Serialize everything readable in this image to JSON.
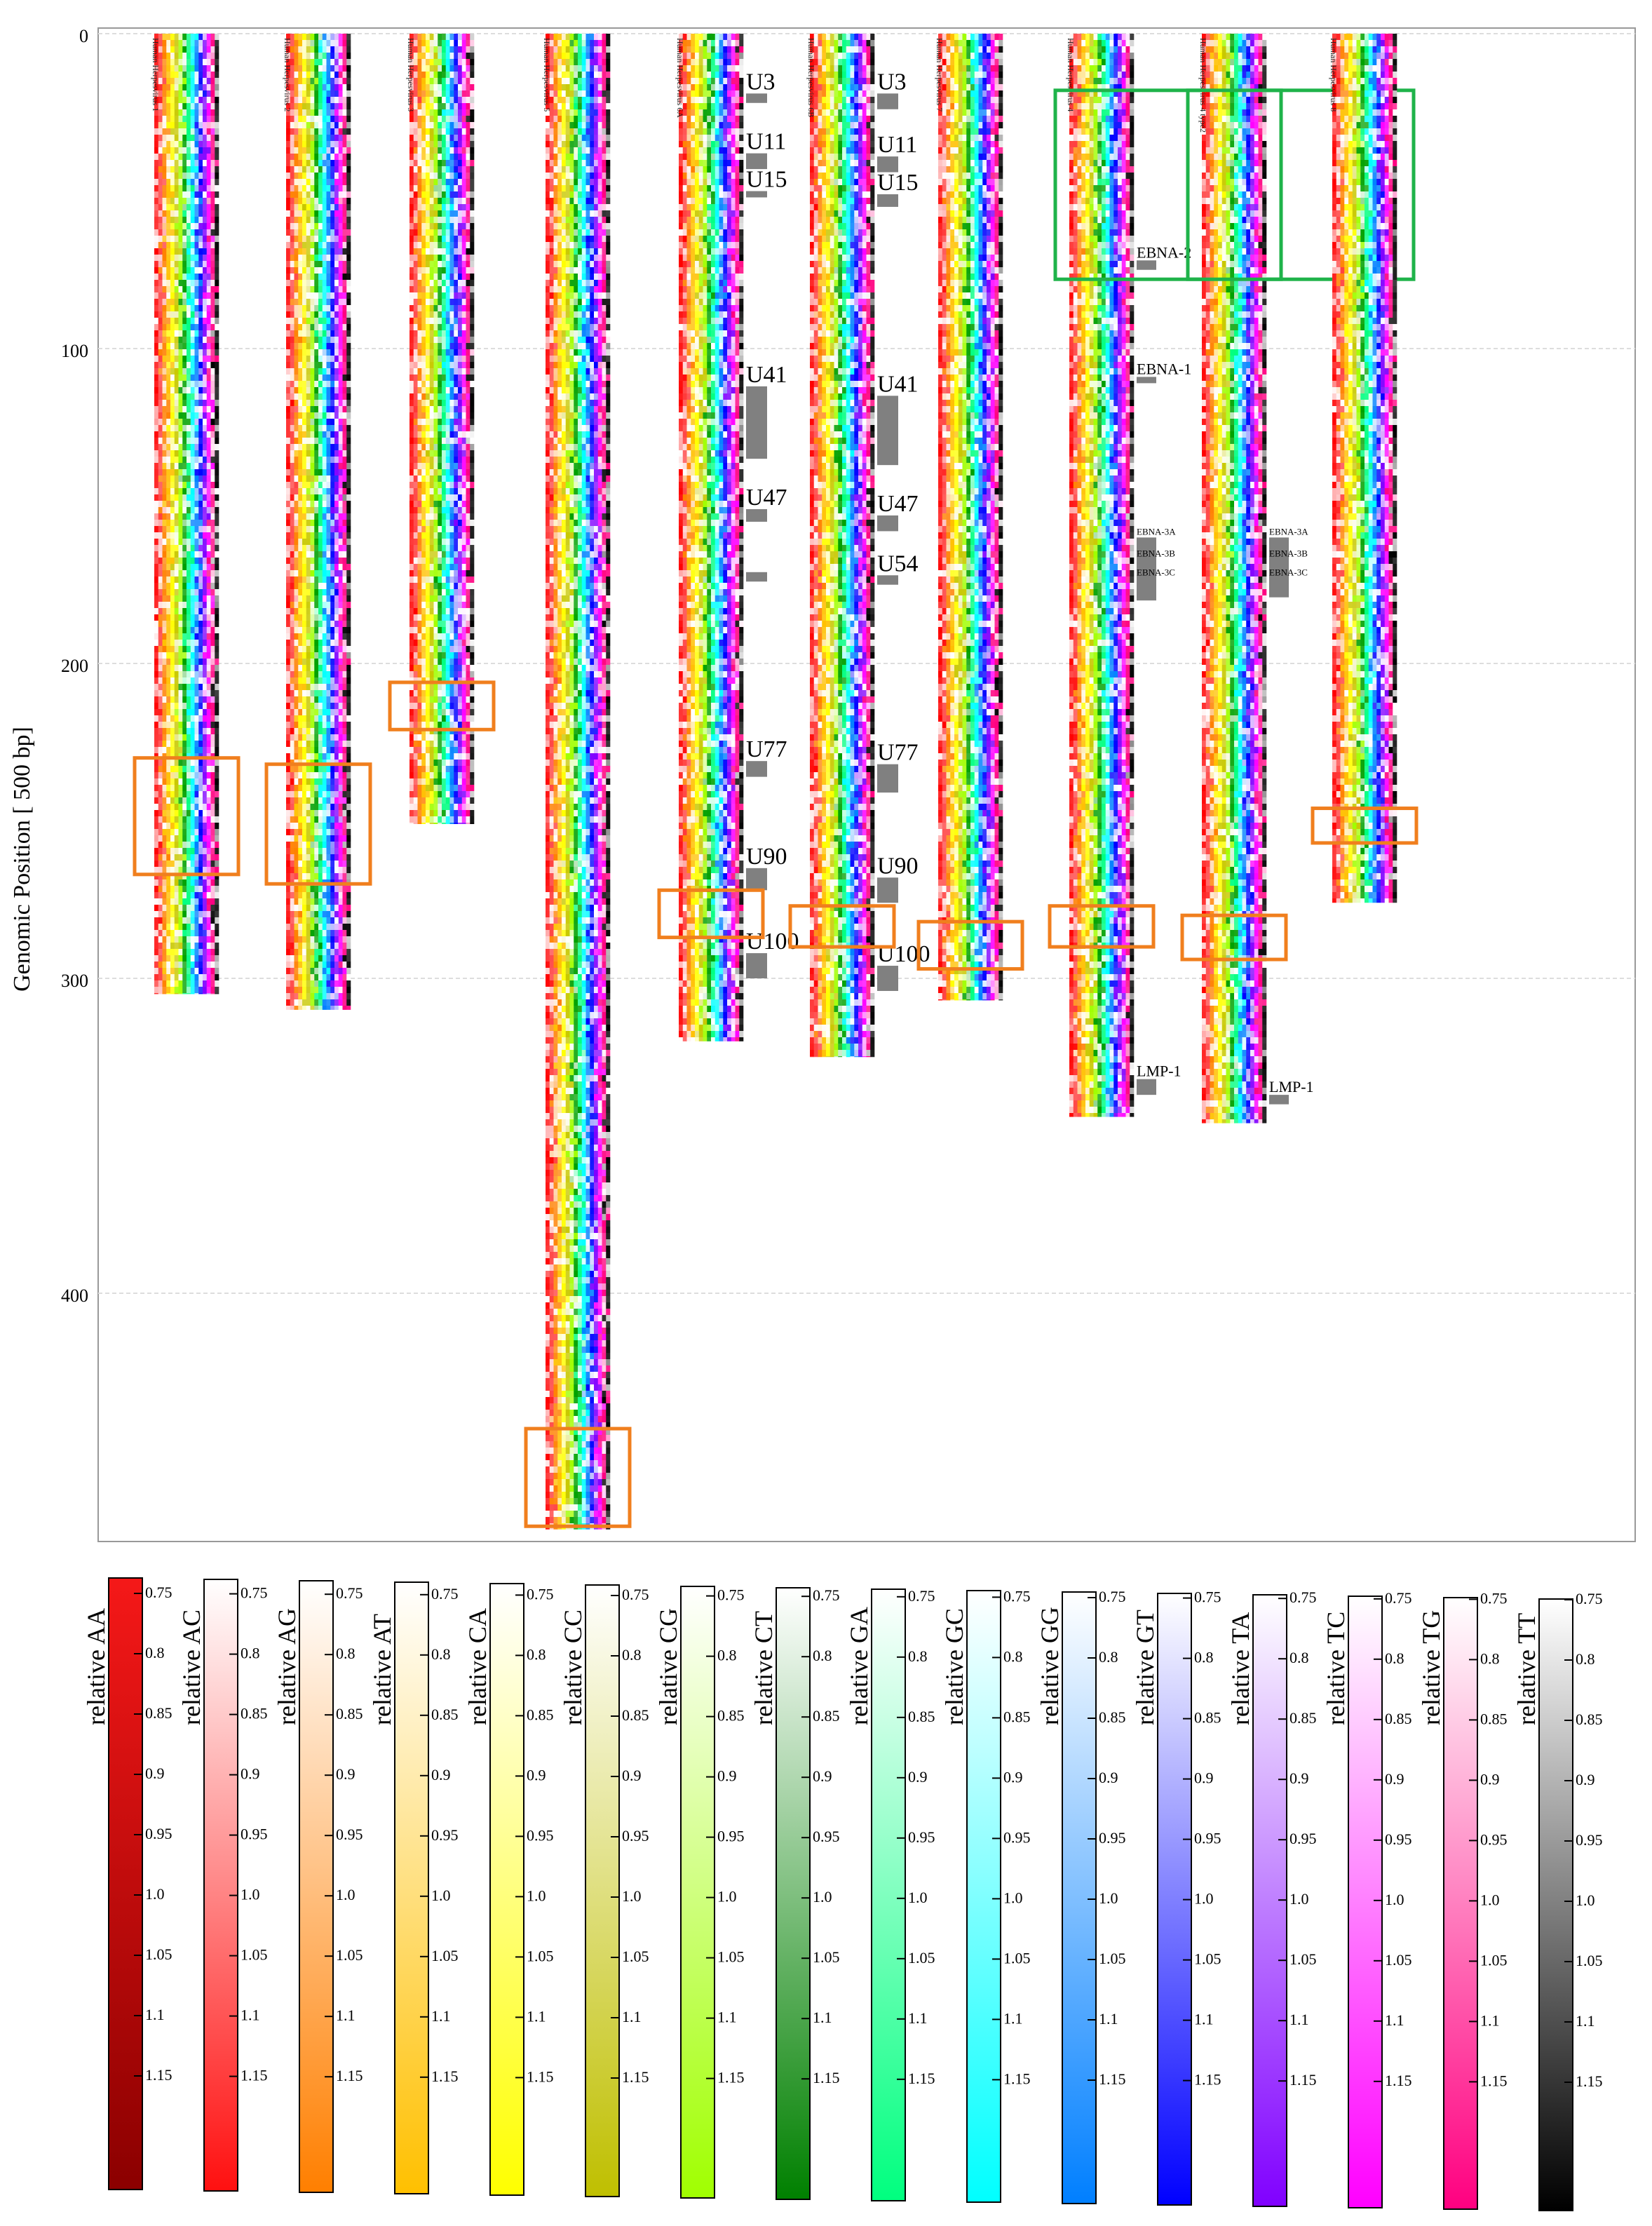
{
  "chart_data": {
    "type": "heatmap",
    "title": "",
    "ylabel": "Genomic Position [ 500 bp]",
    "xlabel": "",
    "y_ticks": [
      0,
      100,
      200,
      300,
      400
    ],
    "ylim": [
      0,
      475
    ],
    "y_reversed": true,
    "grid": true,
    "tracks": [
      {
        "label": "Human Herpesvirus 1",
        "length": 305,
        "highlights": [
          {
            "start": 230,
            "end": 267,
            "color": "#f07f1e"
          }
        ],
        "genes": []
      },
      {
        "label": "Human Herpesvirus 2",
        "length": 310,
        "highlights": [
          {
            "start": 232,
            "end": 270,
            "color": "#f07f1e"
          }
        ],
        "genes": []
      },
      {
        "label": "Human Herpesvirus 3",
        "length": 251,
        "highlights": [
          {
            "start": 206,
            "end": 221,
            "color": "#f07f1e"
          }
        ],
        "genes": []
      },
      {
        "label": "Human Herpesvirus 5",
        "length": 475,
        "highlights": [
          {
            "start": 443,
            "end": 474,
            "color": "#f07f1e"
          }
        ],
        "genes": []
      },
      {
        "label": "Human Herpesvirus 6A",
        "length": 320,
        "highlights": [
          {
            "start": 272,
            "end": 287,
            "color": "#f07f1e"
          }
        ],
        "genes": [
          {
            "name": "U3",
            "start": 19,
            "end": 22
          },
          {
            "name": "U11",
            "start": 38,
            "end": 43
          },
          {
            "name": "U15",
            "start": 50,
            "end": 52
          },
          {
            "name": "U41",
            "start": 112,
            "end": 135
          },
          {
            "name": "U47",
            "start": 151,
            "end": 155
          },
          {
            "name": "",
            "start": 171,
            "end": 174
          },
          {
            "name": "U77",
            "start": 231,
            "end": 236
          },
          {
            "name": "U90",
            "start": 265,
            "end": 272
          },
          {
            "name": "U100",
            "start": 292,
            "end": 300
          }
        ]
      },
      {
        "label": "Human Herpesvirus 6B",
        "length": 325,
        "highlights": [
          {
            "start": 277,
            "end": 290,
            "color": "#f07f1e"
          }
        ],
        "genes": [
          {
            "name": "U3",
            "start": 19,
            "end": 24
          },
          {
            "name": "U11",
            "start": 39,
            "end": 44
          },
          {
            "name": "U15",
            "start": 51,
            "end": 55
          },
          {
            "name": "U41",
            "start": 115,
            "end": 137
          },
          {
            "name": "U47",
            "start": 153,
            "end": 158
          },
          {
            "name": "U54",
            "start": 172,
            "end": 175
          },
          {
            "name": "U77",
            "start": 232,
            "end": 241
          },
          {
            "name": "U90",
            "start": 268,
            "end": 276
          },
          {
            "name": "U100",
            "start": 296,
            "end": 304
          }
        ]
      },
      {
        "label": "Human Herpesvirus 7",
        "length": 307,
        "highlights": [
          {
            "start": 282,
            "end": 297,
            "color": "#f07f1e"
          }
        ],
        "genes": []
      },
      {
        "label": "Human Herpesvirus 4",
        "length": 344,
        "highlights": [
          {
            "start": 277,
            "end": 290,
            "color": "#f07f1e"
          },
          {
            "start": 18,
            "end": 78,
            "color": "#1fb34a"
          }
        ],
        "genes": [
          {
            "name": "EBNA-2",
            "start": 72,
            "end": 75
          },
          {
            "name": "EBNA-1",
            "start": 109,
            "end": 111
          },
          {
            "name": "EBNA-3A",
            "start": 160,
            "end": 180
          },
          {
            "name": "EBNA-3B",
            "start": 0,
            "end": 0
          },
          {
            "name": "EBNA-3C",
            "start": 0,
            "end": 0
          },
          {
            "name": "LMP-1",
            "start": 332,
            "end": 337
          }
        ]
      },
      {
        "label": "Human Herpesvirus 4 type2",
        "length": 346,
        "highlights": [
          {
            "start": 280,
            "end": 294,
            "color": "#f07f1e"
          },
          {
            "start": 18,
            "end": 78,
            "color": "#1fb34a"
          }
        ],
        "genes": [
          {
            "name": "EBNA-3A",
            "start": 160,
            "end": 179
          },
          {
            "name": "EBNA-3B",
            "start": 0,
            "end": 0
          },
          {
            "name": "EBNA-3C",
            "start": 0,
            "end": 0
          },
          {
            "name": "LMP-1",
            "start": 337,
            "end": 340
          }
        ]
      },
      {
        "label": "Human Herpesvirus 8",
        "length": 276,
        "highlights": [
          {
            "start": 246,
            "end": 257,
            "color": "#f07f1e"
          }
        ],
        "genes": []
      }
    ],
    "colorbar_ticks": [
      "0.75",
      "0.8",
      "0.85",
      "0.9",
      "0.95",
      "1.0",
      "1.05",
      "1.1",
      "1.15"
    ],
    "colorbars": [
      {
        "label": "relative AA",
        "top": "#f51818",
        "bottom": "#8b0000"
      },
      {
        "label": "relative AC",
        "top": "#ffffff",
        "bottom": "#ff1010"
      },
      {
        "label": "relative AG",
        "top": "#ffffff",
        "bottom": "#ff7f00"
      },
      {
        "label": "relative AT",
        "top": "#ffffff",
        "bottom": "#ffc000"
      },
      {
        "label": "relative CA",
        "top": "#ffffff",
        "bottom": "#ffff00"
      },
      {
        "label": "relative CC",
        "top": "#ffffff",
        "bottom": "#bfbf00"
      },
      {
        "label": "relative CG",
        "top": "#ffffff",
        "bottom": "#a0ff00"
      },
      {
        "label": "relative CT",
        "top": "#ffffff",
        "bottom": "#008000"
      },
      {
        "label": "relative GA",
        "top": "#ffffff",
        "bottom": "#00ff7f"
      },
      {
        "label": "relative GC",
        "top": "#ffffff",
        "bottom": "#00ffff"
      },
      {
        "label": "relative GG",
        "top": "#ffffff",
        "bottom": "#007fff"
      },
      {
        "label": "relative GT",
        "top": "#ffffff",
        "bottom": "#0000ff"
      },
      {
        "label": "relative TA",
        "top": "#ffffff",
        "bottom": "#8000ff"
      },
      {
        "label": "relative TC",
        "top": "#ffffff",
        "bottom": "#ff00ff"
      },
      {
        "label": "relative TG",
        "top": "#ffffff",
        "bottom": "#ff0080"
      },
      {
        "label": "relative TT",
        "top": "#ffffff",
        "bottom": "#000000"
      }
    ],
    "column_palette": [
      "#ff0000",
      "#ff4040",
      "#ff8000",
      "#ffc000",
      "#ffff00",
      "#c8c800",
      "#a0ff00",
      "#00a000",
      "#00ff80",
      "#00ffff",
      "#0080ff",
      "#0000ff",
      "#8000ff",
      "#ff00ff",
      "#ff0080",
      "#000000"
    ]
  }
}
